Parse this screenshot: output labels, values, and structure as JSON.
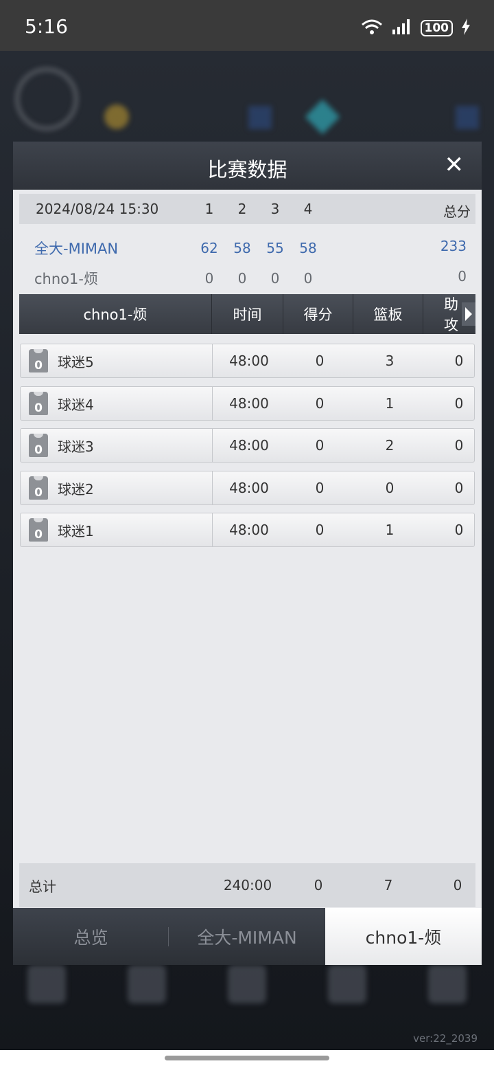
{
  "status_bar": {
    "time": "5:16",
    "battery": "100"
  },
  "background": {
    "version": "ver:22_2039"
  },
  "modal": {
    "title": "比赛数据",
    "close_label": "✕",
    "scoreboard": {
      "date": "2024/08/24 15:30",
      "quarters": [
        "1",
        "2",
        "3",
        "4"
      ],
      "total_label": "总分",
      "teams": [
        {
          "name": "全大-MIMAN",
          "scores": [
            "62",
            "58",
            "55",
            "58"
          ],
          "total": "233"
        },
        {
          "name": "chno1-烦",
          "scores": [
            "0",
            "0",
            "0",
            "0"
          ],
          "total": "0"
        }
      ]
    },
    "player_table": {
      "team": "chno1-烦",
      "columns": [
        "时间",
        "得分",
        "篮板",
        "助攻"
      ],
      "rows": [
        {
          "jersey": "0",
          "name": "球迷5",
          "time": "48:00",
          "points": "0",
          "rebounds": "3",
          "assists": "0"
        },
        {
          "jersey": "0",
          "name": "球迷4",
          "time": "48:00",
          "points": "0",
          "rebounds": "1",
          "assists": "0"
        },
        {
          "jersey": "0",
          "name": "球迷3",
          "time": "48:00",
          "points": "0",
          "rebounds": "2",
          "assists": "0"
        },
        {
          "jersey": "0",
          "name": "球迷2",
          "time": "48:00",
          "points": "0",
          "rebounds": "0",
          "assists": "0"
        },
        {
          "jersey": "0",
          "name": "球迷1",
          "time": "48:00",
          "points": "0",
          "rebounds": "1",
          "assists": "0"
        }
      ],
      "totals": {
        "label": "总计",
        "time": "240:00",
        "points": "0",
        "rebounds": "7",
        "assists": "0"
      }
    },
    "tabs": [
      {
        "label": "总览",
        "active": false
      },
      {
        "label": "全大-MIMAN",
        "active": false
      },
      {
        "label": "chno1-烦",
        "active": true
      }
    ]
  },
  "colors": {
    "accent_blue": "#3f6aad",
    "header_dark": "#373b42",
    "panel_bg": "#e9eaed"
  }
}
